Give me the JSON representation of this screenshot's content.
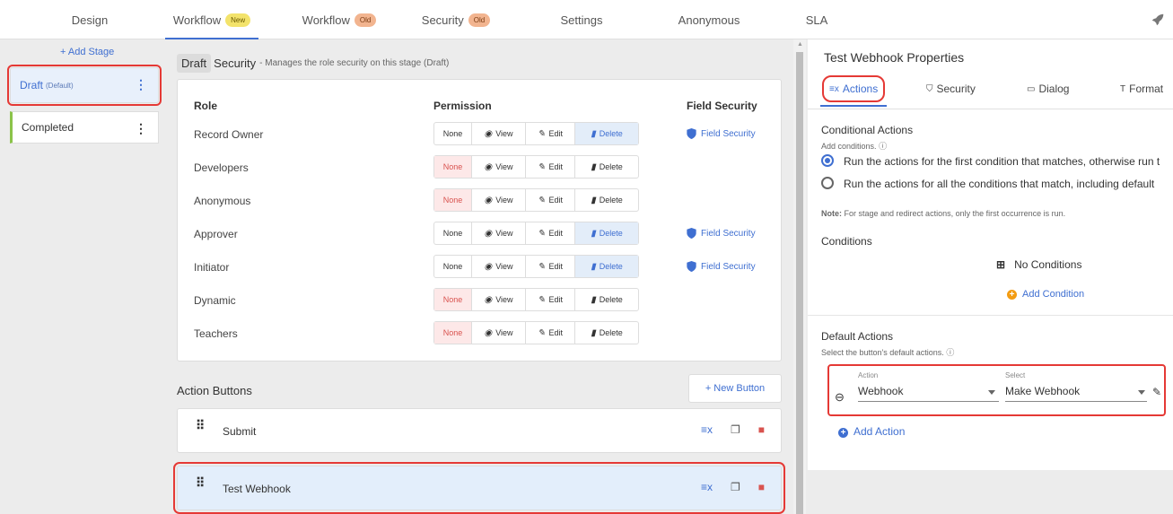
{
  "topnav": {
    "tabs": [
      {
        "label": "Design",
        "badge": ""
      },
      {
        "label": "Workflow",
        "badge": "New"
      },
      {
        "label": "Workflow",
        "badge": "Old"
      },
      {
        "label": "Security",
        "badge": "Old"
      },
      {
        "label": "Settings",
        "badge": ""
      },
      {
        "label": "Anonymous",
        "badge": ""
      },
      {
        "label": "SLA",
        "badge": ""
      }
    ],
    "active_tab": "Workflow New",
    "rocket_icon": "rocket-icon"
  },
  "stages": {
    "add_label": "+ Add Stage",
    "items": [
      {
        "name": "Draft",
        "suffix": "(Default)",
        "selected": true
      },
      {
        "name": "Completed",
        "suffix": "",
        "selected": false
      }
    ]
  },
  "security": {
    "stage_chip": "Draft",
    "title": "Security",
    "description": "- Manages the role security on this stage (Draft)",
    "headers": {
      "role": "Role",
      "permission": "Permission",
      "field_security": "Field Security"
    },
    "perm_labels": {
      "none": "None",
      "view": "View",
      "edit": "Edit",
      "delete": "Delete"
    },
    "field_security_label": "Field Security",
    "roles": [
      {
        "name": "Record Owner",
        "selected": "Delete",
        "field_security": true
      },
      {
        "name": "Developers",
        "selected": "None",
        "field_security": false
      },
      {
        "name": "Anonymous",
        "selected": "None",
        "field_security": false
      },
      {
        "name": "Approver",
        "selected": "Delete",
        "field_security": true
      },
      {
        "name": "Initiator",
        "selected": "Delete",
        "field_security": true
      },
      {
        "name": "Dynamic",
        "selected": "None",
        "field_security": false
      },
      {
        "name": "Teachers",
        "selected": "None",
        "field_security": false
      }
    ]
  },
  "action_buttons": {
    "title": "Action Buttons",
    "new_button": "+ New Button",
    "items": [
      {
        "label": "Submit",
        "selected": false
      },
      {
        "label": "Test Webhook",
        "selected": true
      }
    ]
  },
  "properties": {
    "title": "Test Webhook Properties",
    "tabs": [
      "Actions",
      "Security",
      "Dialog",
      "Format"
    ],
    "active_tab": "Actions",
    "conditional": {
      "title": "Conditional Actions",
      "subtitle": "Add conditions.",
      "option1": "Run the actions for the first condition that matches, otherwise run t",
      "option2": "Run the actions for all the conditions that match, including default",
      "selected_option": 1,
      "note_bold": "Note:",
      "note": "For stage and redirect actions, only the first occurrence is run."
    },
    "conditions": {
      "title": "Conditions",
      "empty": "No Conditions",
      "add": "Add Condition"
    },
    "default_actions": {
      "title": "Default Actions",
      "subtitle": "Select the button's default actions.",
      "action_label": "Action",
      "action_value": "Webhook",
      "select_label": "Select",
      "select_value": "Make Webhook",
      "add": "Add Action"
    }
  }
}
